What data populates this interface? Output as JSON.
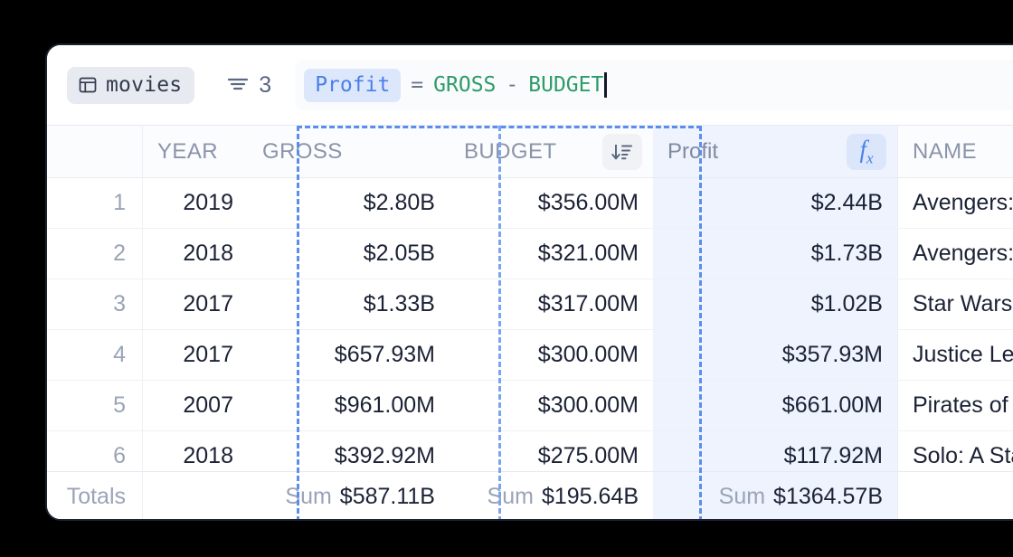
{
  "toolbar": {
    "table_chip": {
      "icon": "table-grid-icon",
      "label": "movies"
    },
    "filter": {
      "icon": "filter-icon",
      "count": "3"
    },
    "formula": {
      "field_name": "Profit",
      "equals": "=",
      "left_ref": "GROSS",
      "operator": "-",
      "right_ref": "BUDGET"
    }
  },
  "grid": {
    "headers": {
      "row_number": "",
      "year": "YEAR",
      "gross": "GROSS",
      "budget": "BUDGET",
      "profit": "Profit",
      "name": "NAME"
    },
    "header_icons": {
      "budget_sort": "sort-descending-icon",
      "profit_formula": "fx-formula-icon"
    },
    "rows": [
      {
        "n": "1",
        "year": "2019",
        "gross": "$2.80B",
        "budget": "$356.00M",
        "profit": "$2.44B",
        "name": "Avengers:"
      },
      {
        "n": "2",
        "year": "2018",
        "gross": "$2.05B",
        "budget": "$321.00M",
        "profit": "$1.73B",
        "name": "Avengers:"
      },
      {
        "n": "3",
        "year": "2017",
        "gross": "$1.33B",
        "budget": "$317.00M",
        "profit": "$1.02B",
        "name": "Star Wars"
      },
      {
        "n": "4",
        "year": "2017",
        "gross": "$657.93M",
        "budget": "$300.00M",
        "profit": "$357.93M",
        "name": "Justice Le"
      },
      {
        "n": "5",
        "year": "2007",
        "gross": "$961.00M",
        "budget": "$300.00M",
        "profit": "$661.00M",
        "name": "Pirates of"
      },
      {
        "n": "6",
        "year": "2018",
        "gross": "$392.92M",
        "budget": "$275.00M",
        "profit": "$117.92M",
        "name": "Solo: A Sta"
      }
    ],
    "totals": {
      "label": "Totals",
      "year": "",
      "gross_word": "Sum",
      "gross_value": "$587.11B",
      "budget_word": "Sum",
      "budget_value": "$195.64B",
      "profit_word": "Sum",
      "profit_value": "$1364.57B",
      "name": ""
    }
  },
  "colors": {
    "accent_blue": "#4a7fe8",
    "formula_green": "#2e9c69",
    "selection_dash": "#5b8def",
    "profit_column_bg": "#eef3fd",
    "page_bg": "#000000"
  }
}
